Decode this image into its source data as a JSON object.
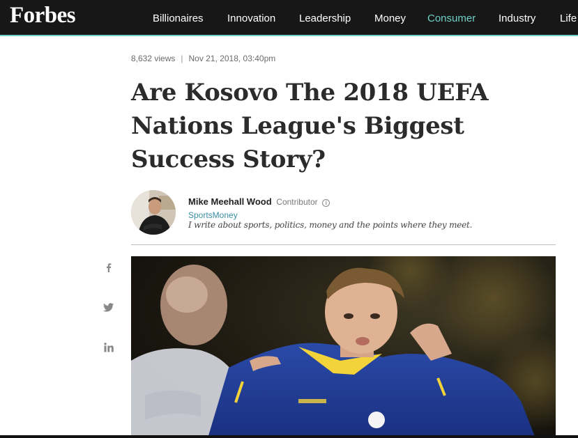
{
  "brand": {
    "logo": "Forbes"
  },
  "nav": {
    "items": [
      {
        "label": "Billionaires",
        "active": false
      },
      {
        "label": "Innovation",
        "active": false
      },
      {
        "label": "Leadership",
        "active": false
      },
      {
        "label": "Money",
        "active": false
      },
      {
        "label": "Consumer",
        "active": true
      },
      {
        "label": "Industry",
        "active": false
      },
      {
        "label": "Life",
        "active": false
      }
    ]
  },
  "article": {
    "views": "8,632 views",
    "separator": "|",
    "date": "Nov 21, 2018, 03:40pm",
    "title": "Are Kosovo The 2018 UEFA Nations League's Biggest Success Story?"
  },
  "author": {
    "name": "Mike Meehall Wood",
    "role": "Contributor",
    "info_icon": "i",
    "channel": "SportsMoney",
    "bio": "I write about sports, politics, money and the points where they meet."
  },
  "share": {
    "icons": [
      "facebook-icon",
      "twitter-icon",
      "linkedin-icon"
    ]
  },
  "colors": {
    "topbar": "#171717",
    "accent": "#6fd1c9",
    "channel_link": "#3a8fa3"
  }
}
